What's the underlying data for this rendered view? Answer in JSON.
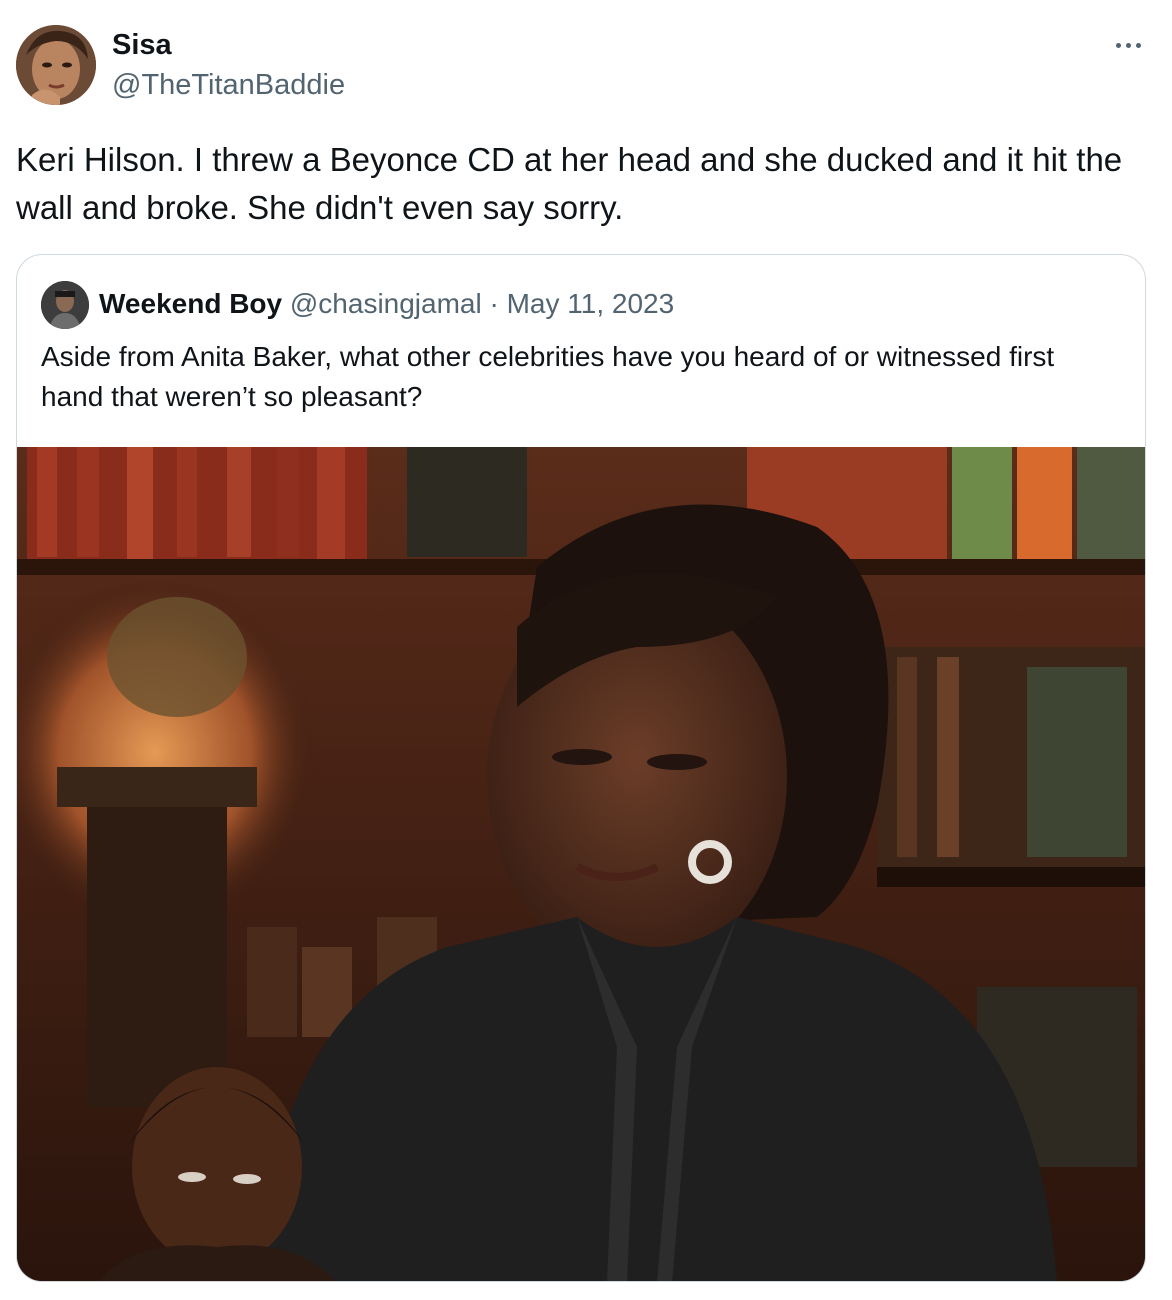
{
  "tweet": {
    "author": {
      "display_name": "Sisa",
      "handle": "@TheTitanBaddie"
    },
    "more_icon": "more-horizontal-icon",
    "text": "Keri Hilson. I threw a Beyonce CD at her head and she ducked and it hit the wall and broke. She didn't even say sorry."
  },
  "quote": {
    "author": {
      "display_name": "Weekend Boy",
      "handle": "@chasingjamal"
    },
    "separator": "·",
    "date": "May 11, 2023",
    "text": "Aside from Anita Baker, what other celebrities have you heard of or witnessed first hand that weren’t so pleasant?"
  },
  "colors": {
    "text": "#0f1419",
    "secondary": "#536471",
    "border": "#cfd9de"
  }
}
